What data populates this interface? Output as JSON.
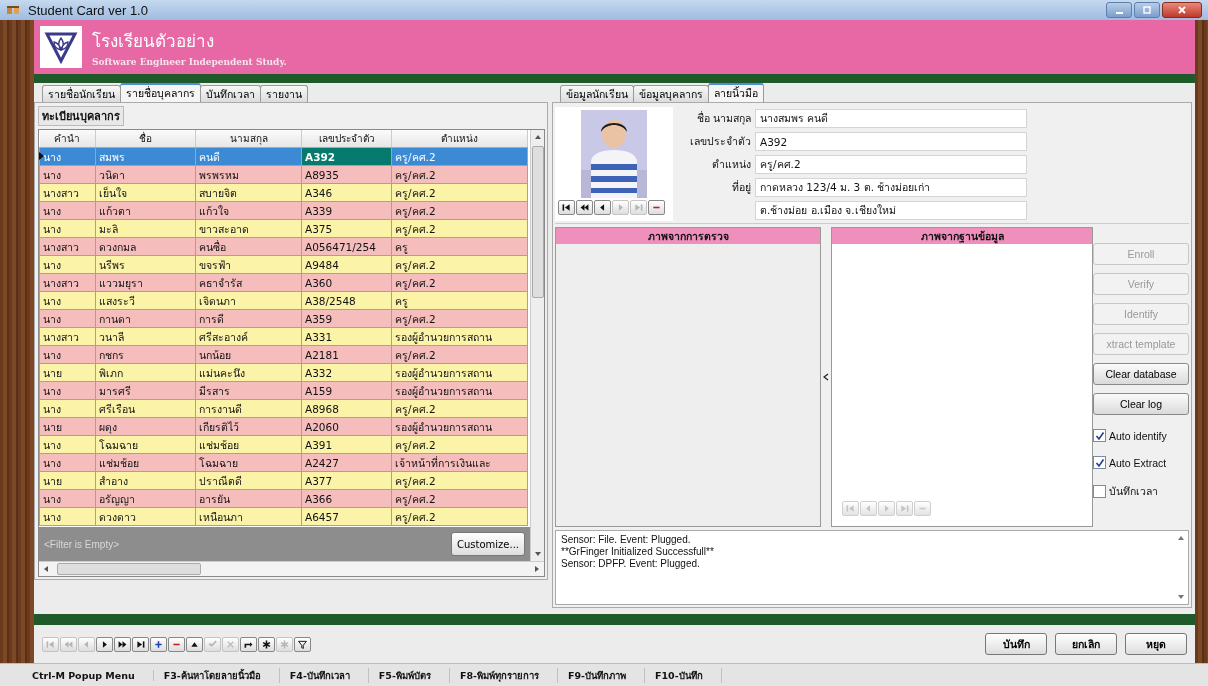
{
  "window": {
    "title": "Student Card ver 1.0"
  },
  "header": {
    "school": "โรงเรียนตัวอย่าง",
    "subtitle": "Software Engineer Independent Study."
  },
  "left_tabs": [
    {
      "label": "รายชื่อนักเรียน",
      "selected": false
    },
    {
      "label": "รายชื่อบุคลากร",
      "selected": true
    },
    {
      "label": "บันทึกเวลา",
      "selected": false
    },
    {
      "label": "รายงาน",
      "selected": false
    }
  ],
  "staff_panel": {
    "title": "ทะเบียนบุคลากร"
  },
  "table": {
    "columns": [
      {
        "label": "คำนำ",
        "focused": false
      },
      {
        "label": "ชื่อ",
        "focused": false
      },
      {
        "label": "นามสกุล",
        "focused": false
      },
      {
        "label": "เลขประจำตัว",
        "focused": true
      },
      {
        "label": "ตำแหน่ง",
        "focused": false
      }
    ],
    "rows": [
      {
        "cells": [
          "นาง",
          "สมพร",
          "คนดี",
          "A392",
          "ครู/คศ.2"
        ],
        "selected": true
      },
      {
        "cells": [
          "นาง",
          "วนิดา",
          "พรพรหม",
          "A8935",
          "ครู/คศ.2"
        ],
        "selected": false
      },
      {
        "cells": [
          "นางสาว",
          "เย็นใจ",
          "สบายจิต",
          "A346",
          "ครู/คศ.2"
        ],
        "selected": false
      },
      {
        "cells": [
          "นาง",
          "แก้วตา",
          "แก้วใจ",
          "A339",
          "ครู/คศ.2"
        ],
        "selected": false
      },
      {
        "cells": [
          "นาง",
          "มะลิ",
          "ขาวสะอาด",
          "A375",
          "ครู/คศ.2"
        ],
        "selected": false
      },
      {
        "cells": [
          "นางสาว",
          "ดวงกมล",
          "คนซื่อ",
          "A056471/254",
          "ครู"
        ],
        "selected": false
      },
      {
        "cells": [
          "นาง",
          "นรีพร",
          "ขจรฟ้า",
          "A9484",
          "ครู/คศ.2"
        ],
        "selected": false
      },
      {
        "cells": [
          "นางสาว",
          "แววมยุรา",
          "คธาจำรัส",
          "A360",
          "ครู/คศ.2"
        ],
        "selected": false
      },
      {
        "cells": [
          "นาง",
          "แสงระวี",
          "เจิดนภา",
          "A38/2548",
          "ครู"
        ],
        "selected": false
      },
      {
        "cells": [
          "นาง",
          "กานดา",
          "การดี",
          "A359",
          "ครู/คศ.2"
        ],
        "selected": false
      },
      {
        "cells": [
          "นางสาว",
          "วนาลี",
          "ศรีสะอางค์",
          "A331",
          "รองผู้อำนวยการสถาน"
        ],
        "selected": false
      },
      {
        "cells": [
          "นาง",
          "กชกร",
          "นกน้อย",
          "A2181",
          "ครู/คศ.2"
        ],
        "selected": false
      },
      {
        "cells": [
          "นาย",
          "พิเภก",
          "แม่นคะนึง",
          "A332",
          "รองผู้อำนวยการสถาน"
        ],
        "selected": false
      },
      {
        "cells": [
          "นาง",
          "มารศรี",
          "มีรสาร",
          "A159",
          "รองผู้อำนวยการสถาน"
        ],
        "selected": false
      },
      {
        "cells": [
          "นาง",
          "ศรีเรือน",
          "การงานดี",
          "A8968",
          "ครู/คศ.2"
        ],
        "selected": false
      },
      {
        "cells": [
          "นาย",
          "ผดุง",
          "เกียรติไว้",
          "A2060",
          "รองผู้อำนวยการสถาน"
        ],
        "selected": false
      },
      {
        "cells": [
          "นาง",
          "โฉมฉาย",
          "แช่มช้อย",
          "A391",
          "ครู/คศ.2"
        ],
        "selected": false
      },
      {
        "cells": [
          "นาง",
          "แช่มช้อย",
          "โฉมฉาย",
          "A2427",
          "เจ้าหน้าที่การเงินและ"
        ],
        "selected": false
      },
      {
        "cells": [
          "นาย",
          "สำอาง",
          "ปราณีตดี",
          "A377",
          "ครู/คศ.2"
        ],
        "selected": false
      },
      {
        "cells": [
          "นาง",
          "อรัญญา",
          "อารยัน",
          "A366",
          "ครู/คศ.2"
        ],
        "selected": false
      },
      {
        "cells": [
          "นาง",
          "ดวงดาว",
          "เหนือนภา",
          "A6457",
          "ครู/คศ.2"
        ],
        "selected": false
      }
    ],
    "filter": "<Filter is Empty>",
    "customize_button": "Customize..."
  },
  "right_tabs": [
    {
      "label": "ข้อมูลนักเรียน",
      "selected": false
    },
    {
      "label": "ข้อมูลบุคลากร",
      "selected": false
    },
    {
      "label": "ลายนิ้วมือ",
      "selected": true
    }
  ],
  "profile": {
    "fields": [
      {
        "label": "ชื่อ นามสกุล",
        "value": "นางสมพร  คนดี"
      },
      {
        "label": "เลขประจำตัว",
        "value": "A392"
      },
      {
        "label": "ตำแหน่ง",
        "value": "ครู/คศ.2"
      },
      {
        "label": "ที่อยู่",
        "value": "กาดหลวง 123/4 ม. 3 ต. ช้างม่อยเก่า"
      },
      {
        "value": "ต.ช้างม่อย อ.เมือง จ.เชียงใหม่"
      }
    ],
    "photo_navigator": [
      {
        "kind": "first",
        "disabled": false
      },
      {
        "kind": "prior",
        "disabled": false
      },
      {
        "kind": "prev",
        "disabled": false
      },
      {
        "kind": "next",
        "disabled": true
      },
      {
        "kind": "last",
        "disabled": true
      },
      {
        "kind": "delete",
        "disabled": false
      }
    ]
  },
  "scan_panel": {
    "title": "ภาพจากการตรวจ"
  },
  "database_panel": {
    "title": "ภาพจากฐานข้อมูล",
    "navigator": [
      {
        "kind": "first",
        "disabled": true
      },
      {
        "kind": "prev",
        "disabled": true
      },
      {
        "kind": "next",
        "disabled": true
      },
      {
        "kind": "last",
        "disabled": true
      },
      {
        "kind": "delete",
        "disabled": true
      }
    ]
  },
  "actions": [
    {
      "kind": "button",
      "label": "Enroll",
      "disabled": true
    },
    {
      "kind": "button",
      "label": "Verify",
      "disabled": true
    },
    {
      "kind": "button",
      "label": "Identify",
      "disabled": true
    },
    {
      "kind": "button",
      "label": "xtract template",
      "disabled": true
    },
    {
      "kind": "button",
      "label": "Clear database",
      "disabled": false
    },
    {
      "kind": "button",
      "label": "Clear log",
      "disabled": false
    },
    {
      "kind": "checkbox",
      "label": "Auto identify",
      "checked": true
    },
    {
      "kind": "checkbox",
      "label": "Auto Extract",
      "checked": true
    },
    {
      "kind": "checkbox",
      "label": "บันทึกเวลา",
      "checked": false
    }
  ],
  "log": [
    "Sensor: File. Event: Plugged.",
    "**GrFinger Initialized Successfull**",
    "Sensor: DPFP. Event: Plugged."
  ],
  "record_navigator": [
    {
      "kind": "first",
      "disabled": true
    },
    {
      "kind": "prior",
      "disabled": true
    },
    {
      "kind": "prev",
      "disabled": true
    },
    {
      "kind": "next",
      "disabled": false
    },
    {
      "kind": "nextpage",
      "disabled": false
    },
    {
      "kind": "last",
      "disabled": false
    },
    {
      "kind": "insert",
      "disabled": false
    },
    {
      "kind": "delete",
      "disabled": false
    },
    {
      "kind": "edit",
      "disabled": false
    },
    {
      "kind": "post",
      "disabled": true
    },
    {
      "kind": "cancel",
      "disabled": true
    },
    {
      "kind": "refresh",
      "disabled": false
    },
    {
      "kind": "bookmark",
      "disabled": false
    },
    {
      "kind": "gotobookmark",
      "disabled": true
    },
    {
      "kind": "filter",
      "disabled": false
    }
  ],
  "buttons": [
    "บันทึก",
    "ยกเลิก",
    "หยุด"
  ],
  "status_bar": [
    "Ctrl-M  Popup Menu",
    "F3-ค้นหาโดยลายนิ้วมือ",
    "F4-บันทึกเวลา",
    "F5-พิมพ์บัตร",
    "F8-พิมพ์ทุกรายการ",
    "F9-บันทึกภาพ",
    "F10-บันทึก"
  ]
}
